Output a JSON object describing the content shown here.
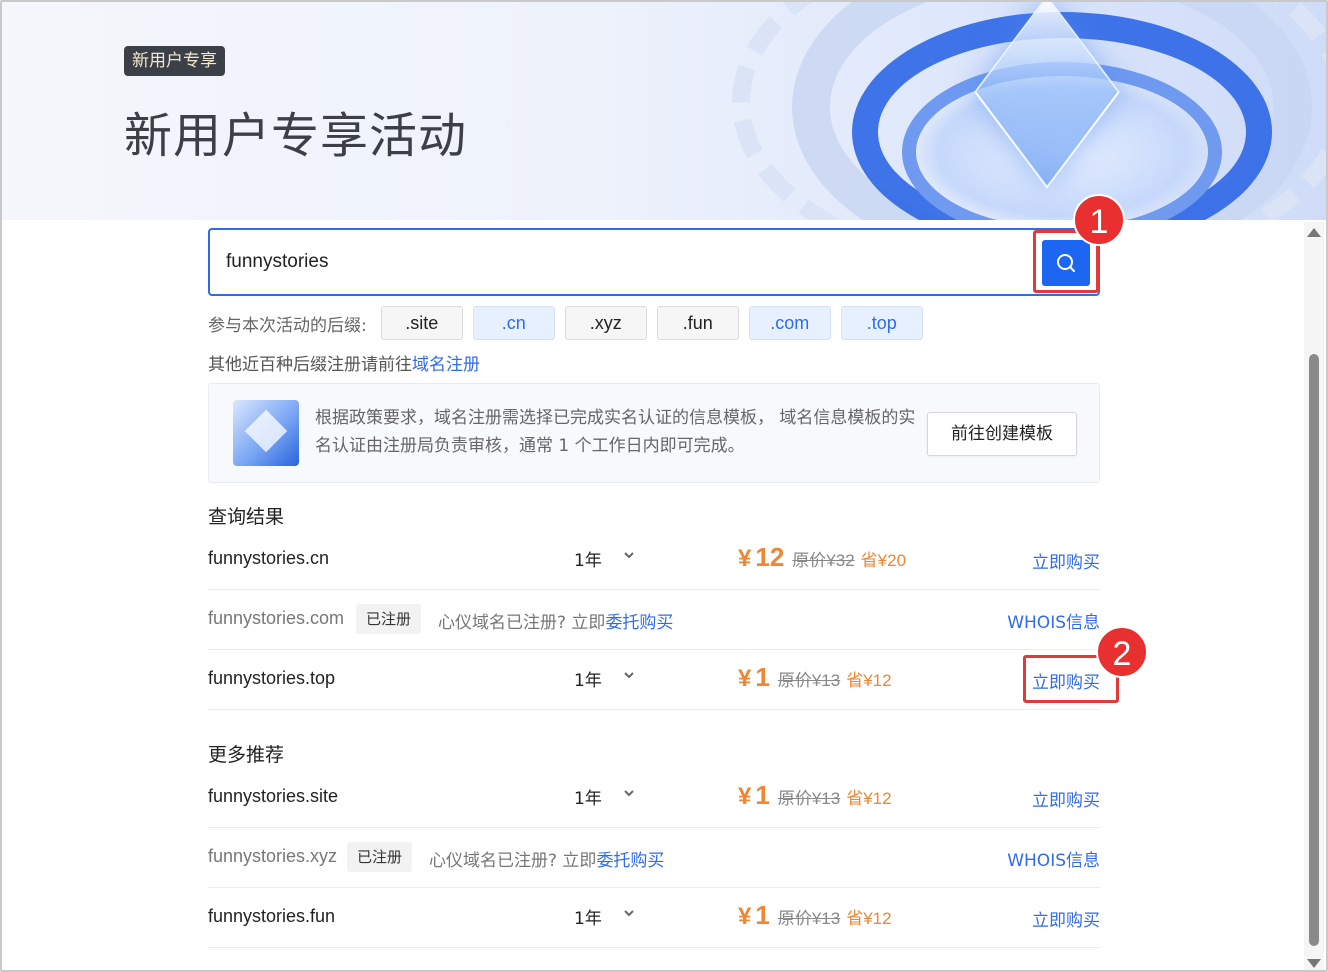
{
  "banner": {
    "badge": "新用户专享",
    "title": "新用户专享活动"
  },
  "search": {
    "value": "funnystories",
    "button_icon": "search-icon"
  },
  "suffixes": {
    "label": "参与本次活动的后缀:",
    "items": [
      {
        "label": ".site",
        "active": false
      },
      {
        "label": ".cn",
        "active": true
      },
      {
        "label": ".xyz",
        "active": false
      },
      {
        "label": ".fun",
        "active": false
      },
      {
        "label": ".com",
        "active": true
      },
      {
        "label": ".top",
        "active": true
      }
    ]
  },
  "other_note": {
    "text": "其他近百种后缀注册请前往",
    "link": "域名注册"
  },
  "policy": {
    "text": "根据政策要求，域名注册需选择已完成实名认证的信息模板，  域名信息模板的实名认证由注册局负责审核，通常 1 个工作日内即可完成。",
    "button": "前往创建模板"
  },
  "results": {
    "title": "查询结果",
    "rows": [
      {
        "domain": "funnystories.cn",
        "period": "1年",
        "currency": "¥",
        "price": "12",
        "original": "原价¥32",
        "save": "省¥20",
        "action": "立即购买"
      },
      {
        "domain": "funnystories.com",
        "tag": "已注册",
        "note": "心仪域名已注册? 立即",
        "note_link": "委托购买",
        "action": "WHOIS信息"
      },
      {
        "domain": "funnystories.top",
        "period": "1年",
        "currency": "¥",
        "price": "1",
        "original": "原价¥13",
        "save": "省¥12",
        "action": "立即购买"
      }
    ]
  },
  "recommend": {
    "title": "更多推荐",
    "rows": [
      {
        "domain": "funnystories.site",
        "period": "1年",
        "currency": "¥",
        "price": "1",
        "original": "原价¥13",
        "save": "省¥12",
        "action": "立即购买"
      },
      {
        "domain": "funnystories.xyz",
        "tag": "已注册",
        "note": "心仪域名已注册? 立即",
        "note_link": "委托购买",
        "action": "WHOIS信息"
      },
      {
        "domain": "funnystories.fun",
        "period": "1年",
        "currency": "¥",
        "price": "1",
        "original": "原价¥13",
        "save": "省¥12",
        "action": "立即购买"
      }
    ]
  },
  "annotations": [
    {
      "number": "1"
    },
    {
      "number": "2"
    }
  ],
  "colors": {
    "accent": "#1c66f2",
    "price": "#f08533",
    "annotation": "#e7302f"
  }
}
